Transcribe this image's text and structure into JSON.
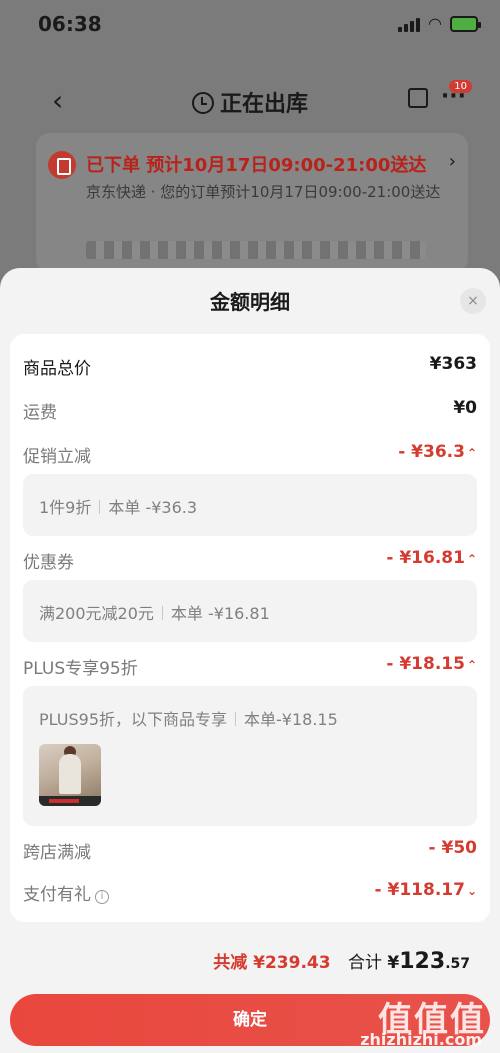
{
  "status_bar": {
    "time": "06:38"
  },
  "header": {
    "back": "‹",
    "title": "正在出库",
    "badge": "10",
    "more": "···"
  },
  "order": {
    "status": "已下单  预计10月17日09:00-21:00送达",
    "desc": "京东快递 · 您的订单预计10月17日09:00-21:00送达"
  },
  "sheet": {
    "title": "金额明细",
    "close": "×",
    "rows": {
      "goods_total": {
        "label": "商品总价",
        "value": "¥363"
      },
      "shipping": {
        "label": "运费",
        "value": "¥0"
      },
      "promo": {
        "label": "促销立减",
        "value": "- ¥36.3",
        "detail_a": "1件9折",
        "detail_b": "本单 -¥36.3"
      },
      "coupon": {
        "label": "优惠券",
        "value": "- ¥16.81",
        "detail_a": "满200元减20元",
        "detail_b": "本单 -¥16.81"
      },
      "plus": {
        "label": "PLUS专享95折",
        "value": "- ¥18.15",
        "detail_a": "PLUS95折，以下商品专享",
        "detail_b": "本单-¥18.15"
      },
      "cross_store": {
        "label": "跨店满减",
        "value": "- ¥50"
      },
      "payment_gift": {
        "label": "支付有礼",
        "value": "- ¥118.17",
        "info": "i"
      }
    },
    "summary": {
      "saved": "共减 ¥239.43",
      "total_label": "合计",
      "yen": "¥",
      "total_int": "123",
      "total_dec": ".57"
    },
    "confirm": "确定"
  },
  "watermark": {
    "logo": "值值值",
    "text": "zhizhizhi.com"
  },
  "colors": {
    "accent": "#d63b2f",
    "button": "#e9473d"
  }
}
